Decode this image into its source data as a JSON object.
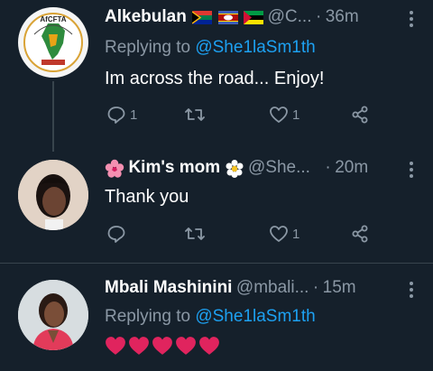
{
  "tweets": [
    {
      "name": "Alkebulan",
      "handle": "@C...",
      "separator": "·",
      "time": "36m",
      "replying_prefix": "Replying to",
      "replying_to": "@She1laSm1th",
      "text": "Im across the road... Enjoy!",
      "reply_count": "1",
      "retweet_count": "",
      "like_count": "1",
      "avatar_text": "AfCFTA"
    },
    {
      "name": "Kim's mom",
      "handle": "@She...",
      "separator": "·",
      "time": "20m",
      "text": "Thank you",
      "reply_count": "",
      "retweet_count": "",
      "like_count": "1"
    },
    {
      "name": "Mbali Mashinini",
      "handle": "@mbali...",
      "separator": "·",
      "time": "15m",
      "replying_prefix": "Replying to",
      "replying_to": "@She1laSm1th",
      "text_emoji": "hearts-x5"
    }
  ],
  "colors": {
    "background": "#15202b",
    "muted": "#8b98a5",
    "accent": "#1da1f2",
    "heart": "#e0245e"
  }
}
